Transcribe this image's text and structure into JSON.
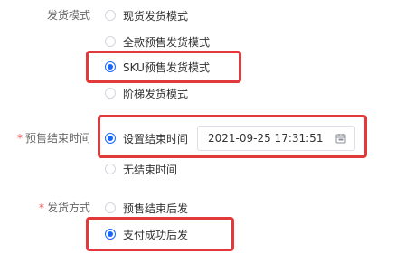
{
  "shipping_mode": {
    "label": "发货模式",
    "options": [
      {
        "label": "现货发货模式",
        "checked": false
      },
      {
        "label": "全款预售发货模式",
        "checked": false
      },
      {
        "label": "SKU预售发货模式",
        "checked": true
      },
      {
        "label": "阶梯发货模式",
        "checked": false
      }
    ]
  },
  "presale_end_time": {
    "required_mark": "*",
    "label": "预售结束时间",
    "options": [
      {
        "label": "设置结束时间",
        "checked": true
      },
      {
        "label": "无结束时间",
        "checked": false
      }
    ],
    "datetime_value": "2021-09-25 17:31:51",
    "calendar_icon": "calendar-icon"
  },
  "delivery_method": {
    "required_mark": "*",
    "label": "发货方式",
    "options": [
      {
        "label": "预售结束后发",
        "checked": false
      },
      {
        "label": "支付成功后发",
        "checked": true
      }
    ]
  },
  "colors": {
    "accent": "#1966ff",
    "highlight_border": "#e23a3a",
    "required": "#ee4d4d"
  }
}
